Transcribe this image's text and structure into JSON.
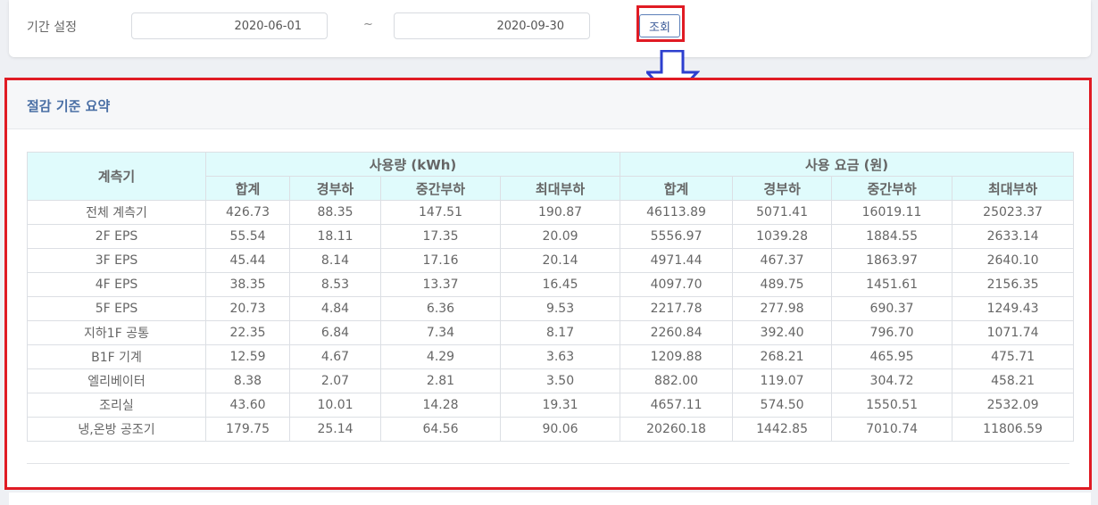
{
  "filter": {
    "period_label": "기간 설정",
    "start_date": "2020-06-01",
    "separator": "~",
    "end_date": "2020-09-30",
    "query_button": "조회"
  },
  "annotation_color": "#e01b24",
  "arrow_color": "#2d3fcf",
  "panel": {
    "title": "절감 기준 요약",
    "row_header": "계측기",
    "groups": [
      "사용량 (kWh)",
      "사용 요금 (원)"
    ],
    "sub_headers": [
      "합계",
      "경부하",
      "중간부하",
      "최대부하",
      "합계",
      "경부하",
      "중간부하",
      "최대부하"
    ],
    "rows": [
      {
        "name": "전체 계측기",
        "values": [
          "426.73",
          "88.35",
          "147.51",
          "190.87",
          "46113.89",
          "5071.41",
          "16019.11",
          "25023.37"
        ]
      },
      {
        "name": "2F EPS",
        "values": [
          "55.54",
          "18.11",
          "17.35",
          "20.09",
          "5556.97",
          "1039.28",
          "1884.55",
          "2633.14"
        ]
      },
      {
        "name": "3F EPS",
        "values": [
          "45.44",
          "8.14",
          "17.16",
          "20.14",
          "4971.44",
          "467.37",
          "1863.97",
          "2640.10"
        ]
      },
      {
        "name": "4F EPS",
        "values": [
          "38.35",
          "8.53",
          "13.37",
          "16.45",
          "4097.70",
          "489.75",
          "1451.61",
          "2156.35"
        ]
      },
      {
        "name": "5F EPS",
        "values": [
          "20.73",
          "4.84",
          "6.36",
          "9.53",
          "2217.78",
          "277.98",
          "690.37",
          "1249.43"
        ]
      },
      {
        "name": "지하1F 공통",
        "values": [
          "22.35",
          "6.84",
          "7.34",
          "8.17",
          "2260.84",
          "392.40",
          "796.70",
          "1071.74"
        ]
      },
      {
        "name": "B1F 기계",
        "values": [
          "12.59",
          "4.67",
          "4.29",
          "3.63",
          "1209.88",
          "268.21",
          "465.95",
          "475.71"
        ]
      },
      {
        "name": "엘리베이터",
        "values": [
          "8.38",
          "2.07",
          "2.81",
          "3.50",
          "882.00",
          "119.07",
          "304.72",
          "458.21"
        ]
      },
      {
        "name": "조리실",
        "values": [
          "43.60",
          "10.01",
          "14.28",
          "19.31",
          "4657.11",
          "574.50",
          "1550.51",
          "2532.09"
        ]
      },
      {
        "name": "냉,온방 공조기",
        "values": [
          "179.75",
          "25.14",
          "64.56",
          "90.06",
          "20260.18",
          "1442.85",
          "7010.74",
          "11806.59"
        ]
      }
    ]
  }
}
